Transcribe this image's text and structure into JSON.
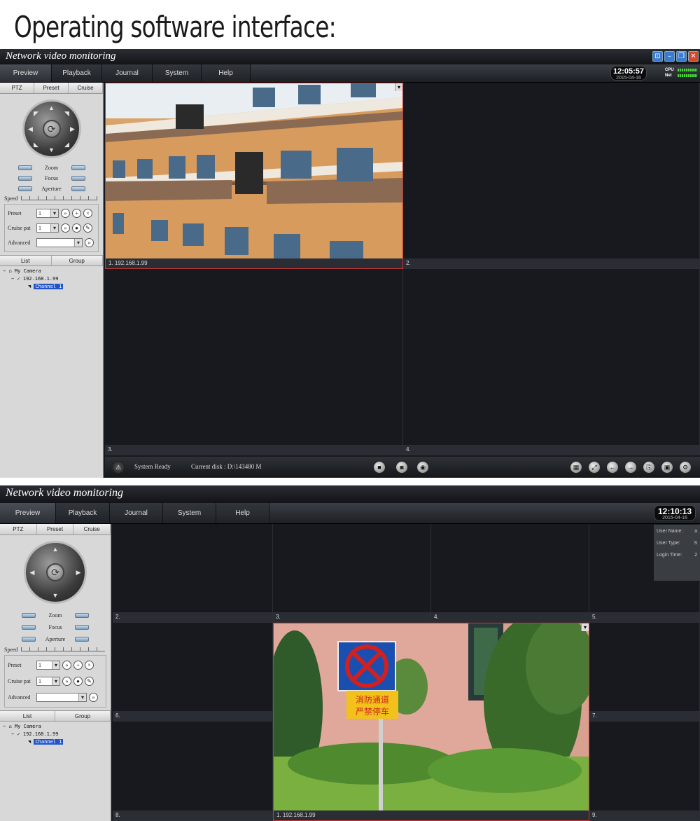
{
  "heading": "Operating software interface:",
  "colors": {
    "accent_red": "#cc3333",
    "panel": "#16191f",
    "meter_green": "#4ddb3a"
  },
  "win1": {
    "title": "Network video monitoring",
    "menu": [
      "Preview",
      "Playback",
      "Journal",
      "System",
      "Help"
    ],
    "clock": {
      "time": "12:05:57",
      "date": "2015-04-16"
    },
    "meters": {
      "cpu": "CPU",
      "net": "Net"
    },
    "side_tabs": [
      "PTZ",
      "Preset",
      "Cruise"
    ],
    "lens": [
      "Zoom",
      "Focus",
      "Aperture"
    ],
    "speed": "Speed",
    "preset_label": "Preset",
    "preset_value": "1",
    "cruise_label": "Cruise pat",
    "cruise_value": "1",
    "advanced_label": "Advanced",
    "list_tabs": [
      "List",
      "Group"
    ],
    "tree": {
      "root": "My Camera",
      "device": "192.168.1.99",
      "channel": "Channel 1"
    },
    "cells": [
      {
        "label": "1.  192.168.1.99",
        "feed": "building"
      },
      {
        "label": "2."
      },
      {
        "label": "3."
      },
      {
        "label": "4."
      }
    ],
    "status": {
      "ready": "System Ready",
      "disk": "Current disk : D:\\143480 M"
    }
  },
  "win2": {
    "title": "Network video monitoring",
    "menu": [
      "Preview",
      "Playback",
      "Journal",
      "System",
      "Help"
    ],
    "clock": {
      "time": "12:10:13",
      "date": "2015-04-16"
    },
    "side_tabs": [
      "PTZ",
      "Preset",
      "Cruise"
    ],
    "lens": [
      "Zoom",
      "Focus",
      "Aperture"
    ],
    "speed": "Speed",
    "preset_label": "Preset",
    "preset_value": "1",
    "cruise_label": "Cruise pat",
    "cruise_value": "1",
    "advanced_label": "Advanced",
    "list_tabs": [
      "List",
      "Group"
    ],
    "tree": {
      "root": "My Camera",
      "device": "192.168.1.99",
      "channel": "Channel 1"
    },
    "info": [
      "User Name:",
      "User Type:",
      "Login Time:"
    ],
    "info_values": [
      "a",
      "S",
      "2"
    ],
    "cells": [
      "2.",
      "3.",
      "4.",
      "5.",
      "6.",
      "7.",
      "8.",
      "9."
    ],
    "main_cell": {
      "label": "1.  192.168.1.99",
      "sign_text_1": "消防通道",
      "sign_text_2": "严禁停车"
    }
  }
}
